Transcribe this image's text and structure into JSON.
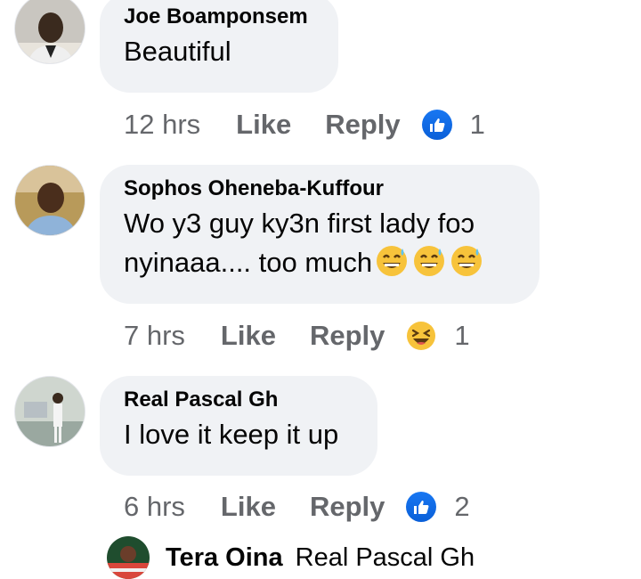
{
  "comments": [
    {
      "author": "Joe Boamponsem",
      "text": "Beautiful",
      "time": "12 hrs",
      "like_label": "Like",
      "reply_label": "Reply",
      "reaction_icon": "like-icon",
      "reaction_count": "1"
    },
    {
      "author": "Sophos Oheneba-Kuffour",
      "text_line1": "Wo y3 guy ky3n first lady foɔ",
      "text_line2": "nyinaaa.... too much",
      "time": "7 hrs",
      "like_label": "Like",
      "reply_label": "Reply",
      "reaction_icon": "haha-icon",
      "reaction_count": "1"
    },
    {
      "author": "Real Pascal Gh",
      "text": "I love it keep it up",
      "time": "6 hrs",
      "like_label": "Like",
      "reply_label": "Reply",
      "reaction_icon": "like-icon",
      "reaction_count": "2"
    }
  ],
  "reply_preview": {
    "author": "Tera Oina",
    "text": "Real Pascal Gh"
  },
  "colors": {
    "bubble": "#f0f2f5",
    "secondary_text": "#65676b",
    "like_blue": "#1877f2",
    "emoji_yellow": "#f7c33b"
  }
}
